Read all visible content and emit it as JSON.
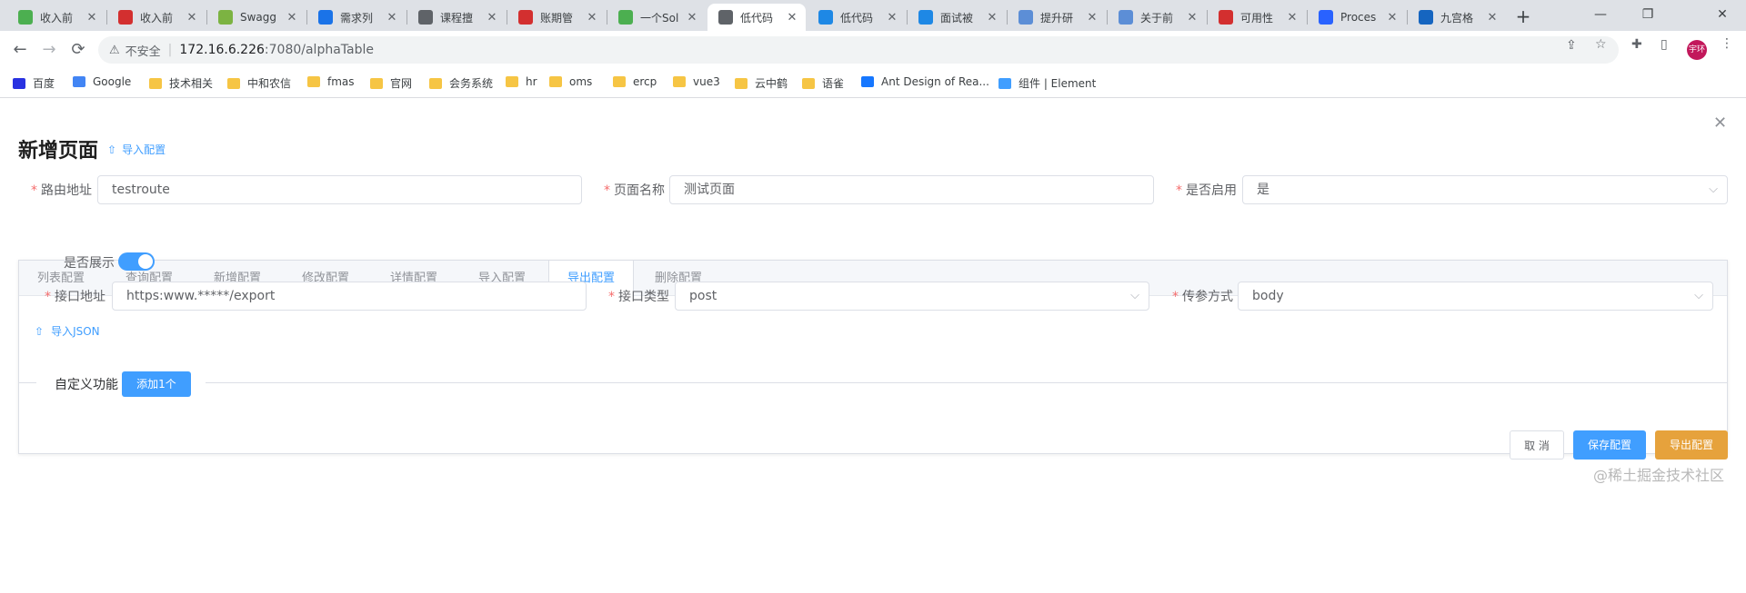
{
  "browser": {
    "tabs": [
      {
        "title": "收入前",
        "favicon": "doc-icon",
        "color": "#4caf50"
      },
      {
        "title": "收入前",
        "favicon": "circle-icon",
        "color": "#d32f2f"
      },
      {
        "title": "Swagg",
        "favicon": "swagger-icon",
        "color": "#7cb342"
      },
      {
        "title": "需求列",
        "favicon": "x-icon",
        "color": "#1a73e8"
      },
      {
        "title": "课程擅",
        "favicon": "globe-icon",
        "color": "#5f6368"
      },
      {
        "title": "账期管",
        "favicon": "circle-icon",
        "color": "#d32f2f"
      },
      {
        "title": "一个Sol",
        "favicon": "doc-icon",
        "color": "#4caf50"
      },
      {
        "title": "低代码",
        "favicon": "globe-icon",
        "color": "#5f6368"
      },
      {
        "title": "低代码",
        "favicon": "chevron-icon",
        "color": "#1e88e5"
      },
      {
        "title": "面试被",
        "favicon": "chevron-icon",
        "color": "#1e88e5"
      },
      {
        "title": "提升研",
        "favicon": "gear-icon",
        "color": "#5c8ed6"
      },
      {
        "title": "关于前",
        "favicon": "gear-icon",
        "color": "#5c8ed6"
      },
      {
        "title": "可用性",
        "favicon": "circle-icon",
        "color": "#d32f2f"
      },
      {
        "title": "Proces",
        "favicon": "c-icon",
        "color": "#2962ff"
      },
      {
        "title": "九宫格",
        "favicon": "on-icon",
        "color": "#1565c0"
      }
    ],
    "active_tab_index": 7,
    "insecure_label": "不安全",
    "url_host": "172.16.6.226",
    "url_path": ":7080/alphaTable",
    "avatar_text": "宇环",
    "bookmarks": [
      {
        "label": "百度",
        "icon": "baidu-icon"
      },
      {
        "label": "Google",
        "icon": "google-icon"
      },
      {
        "label": "技术相关",
        "icon": "folder-icon"
      },
      {
        "label": "中和农信",
        "icon": "folder-icon"
      },
      {
        "label": "fmas",
        "icon": "folder-icon"
      },
      {
        "label": "官网",
        "icon": "folder-icon"
      },
      {
        "label": "会务系统",
        "icon": "folder-icon"
      },
      {
        "label": "hr",
        "icon": "folder-icon"
      },
      {
        "label": "oms",
        "icon": "folder-icon"
      },
      {
        "label": "ercp",
        "icon": "folder-icon"
      },
      {
        "label": "vue3",
        "icon": "folder-icon"
      },
      {
        "label": "云中鹤",
        "icon": "folder-icon"
      },
      {
        "label": "语雀",
        "icon": "folder-icon"
      },
      {
        "label": "Ant Design of Rea...",
        "icon": "antd-icon"
      },
      {
        "label": "组件 | Element",
        "icon": "element-icon"
      }
    ]
  },
  "page": {
    "title": "新增页面",
    "import_config": "导入配置",
    "required_mark": "*",
    "route_label": "路由地址",
    "route_value": "testroute",
    "name_label": "页面名称",
    "name_value": "测试页面",
    "enabled_label": "是否启用",
    "enabled_value": "是",
    "config_tabs": [
      "列表配置",
      "查询配置",
      "新增配置",
      "修改配置",
      "详情配置",
      "导入配置",
      "导出配置",
      "删除配置"
    ],
    "active_config_tab": 6,
    "show_label": "是否展示",
    "show_enabled": true,
    "api_label": "接口地址",
    "api_value": "https:www.*****/export",
    "api_type_label": "接口类型",
    "api_type_value": "post",
    "param_mode_label": "传参方式",
    "param_mode_value": "body",
    "import_json": "导入JSON",
    "custom_label": "自定义功能",
    "add_button": "添加1个",
    "cancel_button": "取 消",
    "save_button": "保存配置",
    "export_button": "导出配置",
    "watermark": "@稀土掘金技术社区"
  },
  "colors": {
    "primary": "#409eff",
    "warning": "#e6a23c",
    "required": "#f56c6c"
  }
}
